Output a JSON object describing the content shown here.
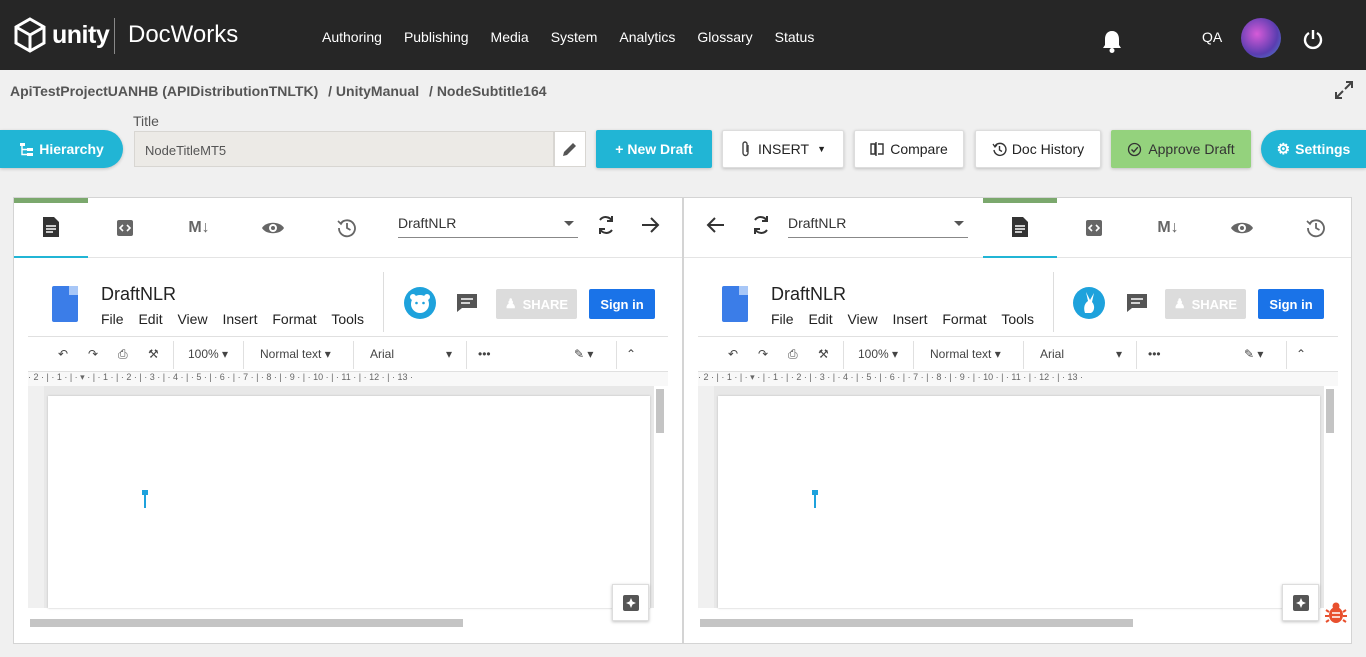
{
  "app": {
    "brand_word": "unity",
    "name": "DocWorks"
  },
  "nav": [
    "Authoring",
    "Publishing",
    "Media",
    "System",
    "Analytics",
    "Glossary",
    "Status"
  ],
  "user": {
    "initials": "QA"
  },
  "breadcrumb": [
    "ApiTestProjectUANHB (APIDistributionTNLTK)",
    "/ UnityManual",
    "/ NodeSubtitle164"
  ],
  "toolbar": {
    "hierarchy": "Hierarchy",
    "title_label": "Title",
    "title_value": "NodeTitleMT5",
    "new_draft": "+ New Draft",
    "insert": "INSERT",
    "compare": "Compare",
    "doc_history": "Doc History",
    "approve_draft": "Approve Draft",
    "settings": "Settings"
  },
  "left_panel": {
    "draft_select": "DraftNLR",
    "doc_name": "DraftNLR",
    "menu": [
      "File",
      "Edit",
      "View",
      "Insert",
      "Format",
      "Tools"
    ],
    "share": "SHARE",
    "sign_in": "Sign in",
    "zoom": "100%",
    "style": "Normal text",
    "font": "Arial"
  },
  "right_panel": {
    "draft_select": "DraftNLR",
    "doc_name": "DraftNLR",
    "menu": [
      "File",
      "Edit",
      "View",
      "Insert",
      "Format",
      "Tools"
    ],
    "share": "SHARE",
    "sign_in": "Sign in",
    "zoom": "100%",
    "style": "Normal text",
    "font": "Arial"
  },
  "ruler_text": "· 2 · | · 1 · | · ▾ · | · 1 · | · 2 · | · 3 · | · 4 · | · 5 · | · 6 · | · 7 · | · 8 · | · 9 · | · 10 · | · 11 · | · 12 · | · 13 ·",
  "colors": {
    "accent": "#21b5d5",
    "approve": "#94d27d",
    "topbar": "#262626",
    "gdocs_blue": "#1a73e8"
  }
}
